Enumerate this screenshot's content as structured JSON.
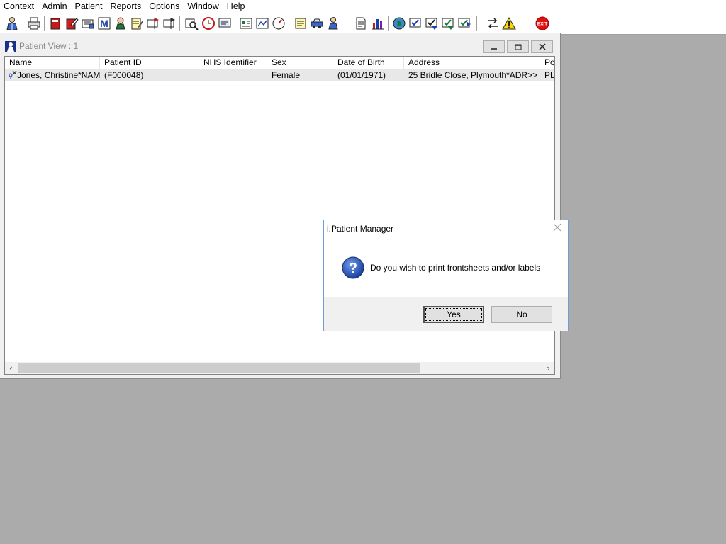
{
  "menubar": {
    "items": [
      "Context",
      "Admin",
      "Patient",
      "Reports",
      "Options",
      "Window",
      "Help"
    ]
  },
  "toolbar": {
    "icons": [
      "doctor-icon",
      "printer-icon",
      "book-icon",
      "notebook-edit-icon",
      "card-icon",
      "m-mail-icon",
      "person-icon",
      "form-icon",
      "flag-card-icon",
      "flag-card-2-icon",
      "search-card-icon",
      "clock-icon",
      "monitor-icon",
      "report-icon",
      "report-2-icon",
      "gauge-icon",
      "notes-icon",
      "car-icon",
      "person-move-icon",
      "document-icon",
      "chart-icon",
      "globe-icon",
      "check-doc-icon",
      "check-doc-2-icon",
      "transfer-icon",
      "transfer-2-icon",
      "swap-icon",
      "warning-icon",
      "exit-icon"
    ],
    "exit_label": "EXIT"
  },
  "child_window": {
    "title": "Patient View : 1",
    "columns": [
      "Name",
      "Patient ID",
      "NHS Identifier",
      "Sex",
      "Date of Birth",
      "Address",
      "Po"
    ],
    "rows": [
      {
        "name": "Jones, Christine*NAM...",
        "patient_id": "(F000048)",
        "nhs_identifier": "",
        "sex": "Female",
        "dob": "(01/01/1971)",
        "address": "25 Bridle Close, Plymouth*ADR>>",
        "po": "PL"
      }
    ]
  },
  "dialog": {
    "title": "i.Patient Manager",
    "message": "Do you wish to print frontsheets and/or labels",
    "yes_label": "Yes",
    "no_label": "No"
  },
  "colors": {
    "desktop": "#ababab",
    "dialog_border": "#6e9fd3",
    "selected_row": "#e8e8e8"
  }
}
